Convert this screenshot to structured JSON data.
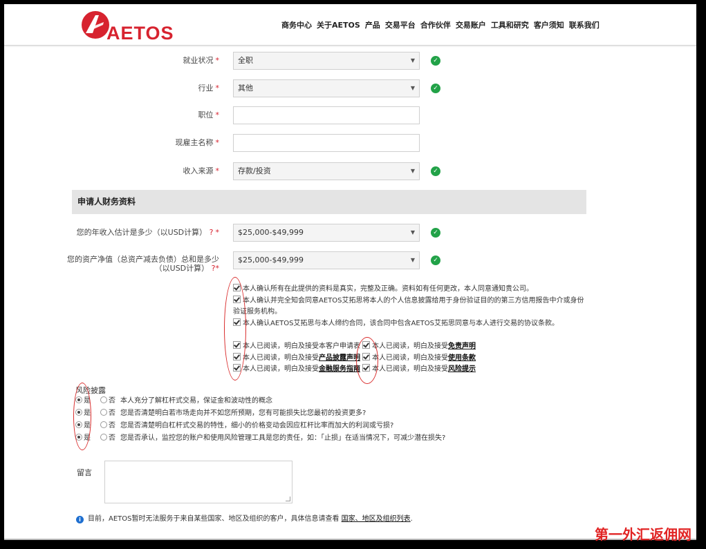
{
  "header": {
    "brand": "AETOS",
    "nav": [
      "商务中心",
      "关于AETOS",
      "产品",
      "交易平台",
      "合作伙伴",
      "交易账户",
      "工具和研究",
      "客户须知",
      "联系我们"
    ]
  },
  "employment": {
    "status": {
      "label": "就业状况",
      "value": "全职"
    },
    "industry": {
      "label": "行业",
      "value": "其他"
    },
    "position": {
      "label": "职位",
      "value": ""
    },
    "employer": {
      "label": "现雇主名称",
      "value": ""
    },
    "income_source": {
      "label": "收入来源",
      "value": "存款/投资"
    }
  },
  "finance": {
    "section_title": "申请人财务资料",
    "annual_income": {
      "label": "您的年收入估计是多少（以USD计算）",
      "value": "$25,000-$49,999"
    },
    "net_worth": {
      "label_line1": "您的资产净值（总资产减去负债）总和是多少",
      "label_line2": "（以USD计算）",
      "value": "$25,000-$49,999"
    },
    "q_mark": "?",
    "req_mark": "*"
  },
  "confirmations": [
    "本人确认所有在此提供的资料是真实，完整及正确。资料如有任何更改，本人同意通知贵公司。",
    "本人确认并完全知会同意AETOS艾拓思将本人的个人信息披露给用于身份验证目的的第三方信用报告中介或身份",
    "验证服务机构。",
    "本人确认AETOS艾拓思与本人缔约合同，该合同中包含AETOS艾拓思同意与本人进行交易的协议条款。"
  ],
  "agreements": {
    "prefix": "本人已阅读，明白及接受",
    "left": [
      "本客户申请表",
      "产品披露声明",
      "金融服务指南"
    ],
    "right": [
      "免责声明",
      "使用条款",
      "风险提示"
    ]
  },
  "risk": {
    "title": "风险披露",
    "yes": "是",
    "no": "否",
    "questions": [
      "本人充分了解杠杆式交易，保证金和波动性的概念",
      "您是否清楚明白若市场走向并不如您所预期，您有可能损失比您最初的投资更多?",
      "您是否清楚明白杠杆式交易的特性，细小的价格变动会因应杠杆比率而加大的利润或亏损?",
      "您是否承认，监控您的账户和使用风险管理工具是您的责任，如：「止损」在适当情况下，可减少潜在损失?"
    ]
  },
  "message": {
    "label": "留言",
    "value": ""
  },
  "notice": {
    "text": "目前，AETOS暂时无法服务于来自某些国家、地区及组织的客户，具体信息请查看 ",
    "link": "国家、地区及组织列表",
    "end": "."
  },
  "watermark": "第一外汇返佣网",
  "colors": {
    "brand": "#d7232f",
    "ok": "#22a248",
    "annotation": "#d92b2b"
  }
}
